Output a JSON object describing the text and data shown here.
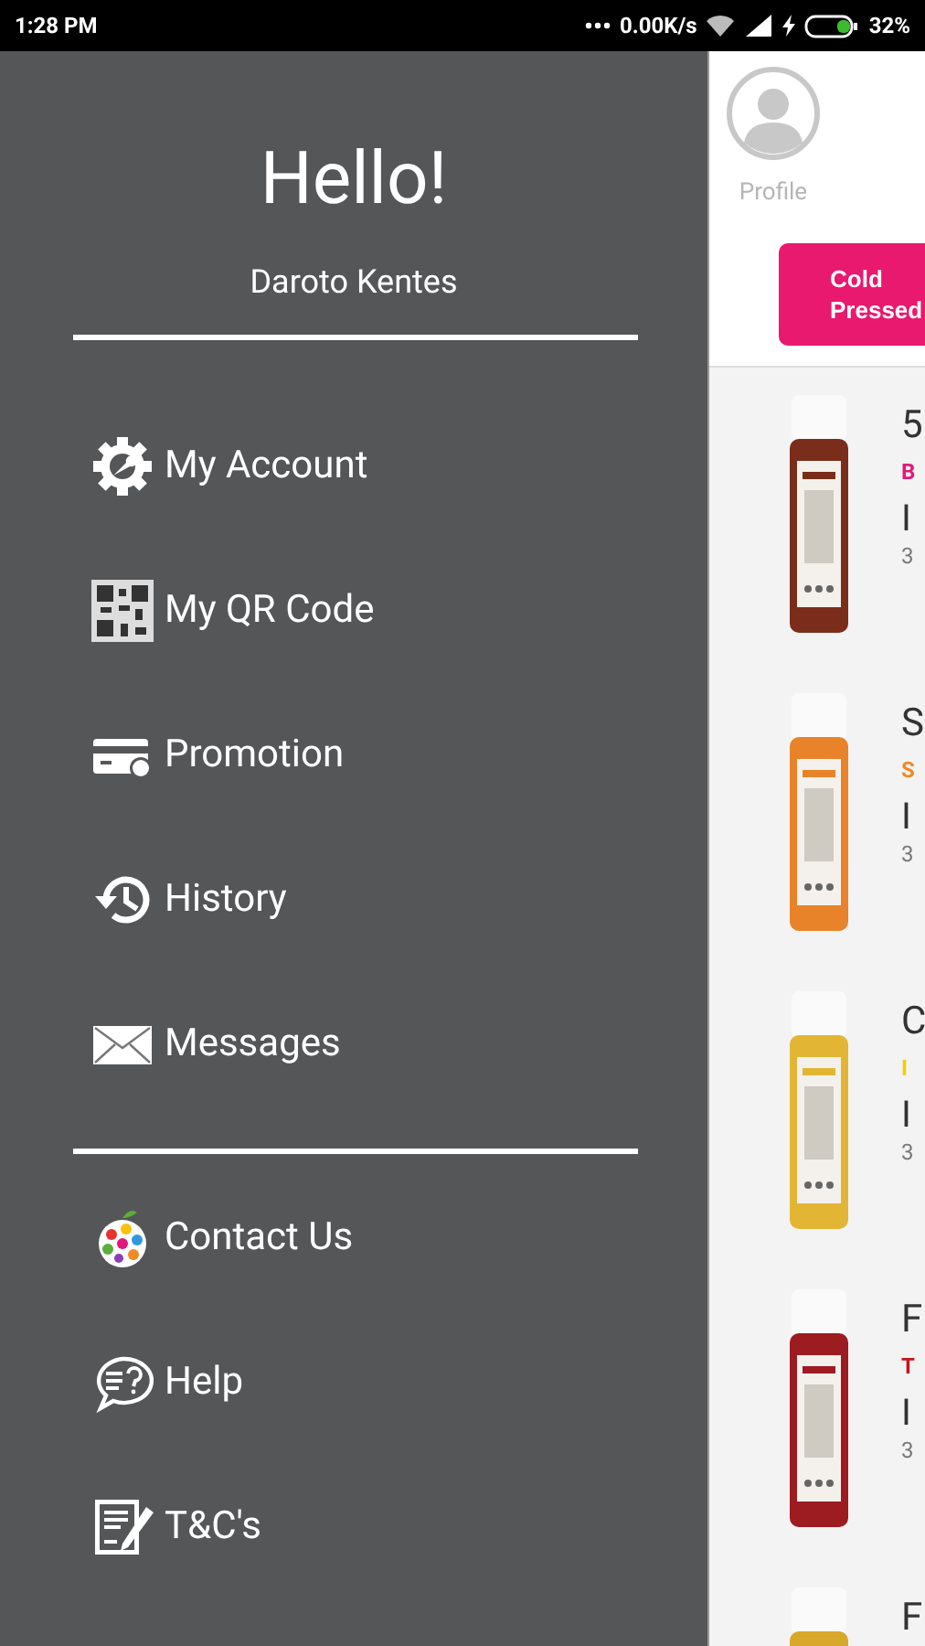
{
  "status_bar": {
    "time": "1:28 PM",
    "speed": "0.00K/s",
    "battery": "32%"
  },
  "drawer": {
    "greeting": "Hello!",
    "user_name": "Daroto Kentes",
    "sections": [
      [
        {
          "kind": "account",
          "label": "My Account"
        },
        {
          "kind": "qr",
          "label": "My QR Code"
        },
        {
          "kind": "promotion",
          "label": "Promotion"
        },
        {
          "kind": "history",
          "label": "History"
        },
        {
          "kind": "messages",
          "label": "Messages"
        }
      ],
      [
        {
          "kind": "contact",
          "label": "Contact Us"
        },
        {
          "kind": "help",
          "label": "Help"
        },
        {
          "kind": "terms",
          "label": "T&C's"
        }
      ]
    ]
  },
  "main": {
    "profile_label": "Profile",
    "category_button": "Cold Pressed",
    "products": [
      {
        "title": "5",
        "tag": "B",
        "color": "#e0197a",
        "line_3": "I",
        "line_4": "3"
      },
      {
        "title": "S",
        "tag": "S",
        "color": "#f08a24",
        "line_3": "I",
        "line_4": "3"
      },
      {
        "title": "C",
        "tag": "I",
        "color": "#f2cf00",
        "line_3": "I",
        "line_4": "3"
      },
      {
        "title": "F",
        "tag": "T",
        "color": "#c4161c",
        "line_3": "I",
        "line_4": "3"
      },
      {
        "title": "F"
      }
    ]
  }
}
